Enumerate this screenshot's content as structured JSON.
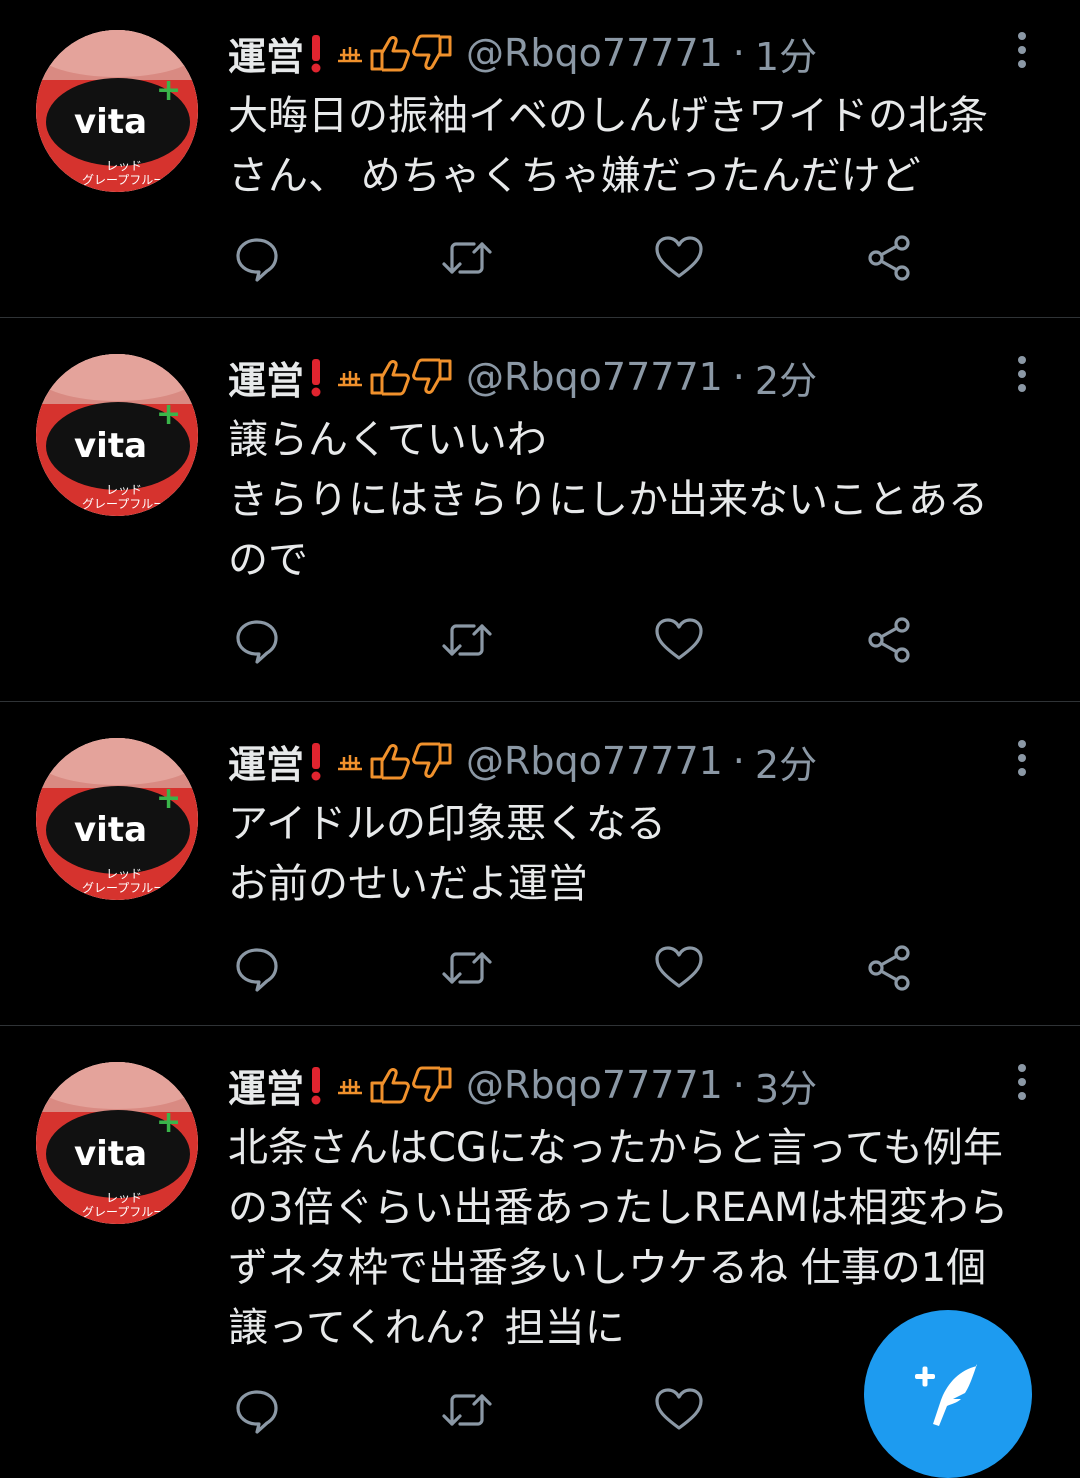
{
  "tweets": [
    {
      "name": "運営",
      "name_emoji": [
        "exclamation-icon",
        "cityscape-icon",
        "thumbs-up-icon",
        "thumbs-down-icon"
      ],
      "handle": "@Rbqo77771",
      "separator": "·",
      "time": "1分",
      "text_lines": [
        "大晦日の振袖イベのしんげきワイドの北条",
        "さん、 めちゃくちゃ嫌だったんだけど"
      ]
    },
    {
      "name": "運営",
      "name_emoji": [
        "exclamation-icon",
        "cityscape-icon",
        "thumbs-up-icon",
        "thumbs-down-icon"
      ],
      "handle": "@Rbqo77771",
      "separator": "·",
      "time": "2分",
      "text_lines": [
        "譲らんくていいわ",
        "きらりにはきらりにしか出来ないことある",
        "ので"
      ]
    },
    {
      "name": "運営",
      "name_emoji": [
        "exclamation-icon",
        "cityscape-icon",
        "thumbs-up-icon",
        "thumbs-down-icon"
      ],
      "handle": "@Rbqo77771",
      "separator": "·",
      "time": "2分",
      "text_lines": [
        "アイドルの印象悪くなる",
        "お前のせいだよ運営"
      ]
    },
    {
      "name": "運営",
      "name_emoji": [
        "exclamation-icon",
        "cityscape-icon",
        "thumbs-up-icon",
        "thumbs-down-icon"
      ],
      "handle": "@Rbqo77771",
      "separator": "·",
      "time": "3分",
      "text_lines": [
        "北条さんはCGになったからと言っても例年",
        "の3倍ぐらい出番あったしREAMは相変わら",
        "ずネタ枠で出番多いしウケるね 仕事の1個",
        "譲ってくれん？担当に"
      ]
    }
  ],
  "avatar": {
    "brand": "vita",
    "label_line1": "レッド",
    "label_line2": "グレープフルーツ"
  },
  "colors": {
    "background": "#000000",
    "text": "#e7e9ea",
    "secondary": "#8b98a5",
    "divider": "#2f3336",
    "accent": "#1d9bf0",
    "emoji_red": "#e0242f",
    "emoji_orange": "#f0912c"
  },
  "icons": {
    "reply": "reply-icon",
    "retweet": "retweet-icon",
    "like": "heart-icon",
    "share": "share-icon",
    "more": "more-vertical-icon",
    "compose": "compose-tweet-icon"
  }
}
